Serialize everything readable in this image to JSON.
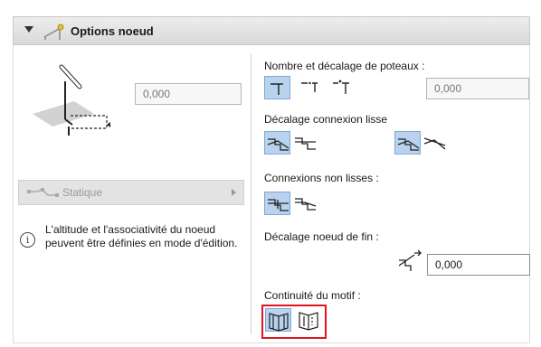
{
  "header": {
    "title": "Options noeud",
    "icon": "railing-icon",
    "collapse_icon": "caret-down-icon"
  },
  "left": {
    "elevation_value": "0,000",
    "mode_dropdown": {
      "label": "Statique",
      "icon": "static-node-icon"
    },
    "info_text": "L'altitude et l'associativité du noeud peuvent être définies en mode d'édition."
  },
  "right": {
    "post_offset": {
      "label": "Nombre et décalage de poteaux :",
      "value": "0,000"
    },
    "smooth_offset": {
      "label": "Décalage connexion lisse"
    },
    "non_smooth": {
      "label": "Connexions non lisses :"
    },
    "end_offset": {
      "label": "Décalage noeud de fin :",
      "value": "0,000"
    },
    "pattern_continuity": {
      "label": "Continuité du motif :"
    }
  },
  "colors": {
    "selected_button": "#b9d3ee",
    "highlight_box": "#e0141e"
  }
}
